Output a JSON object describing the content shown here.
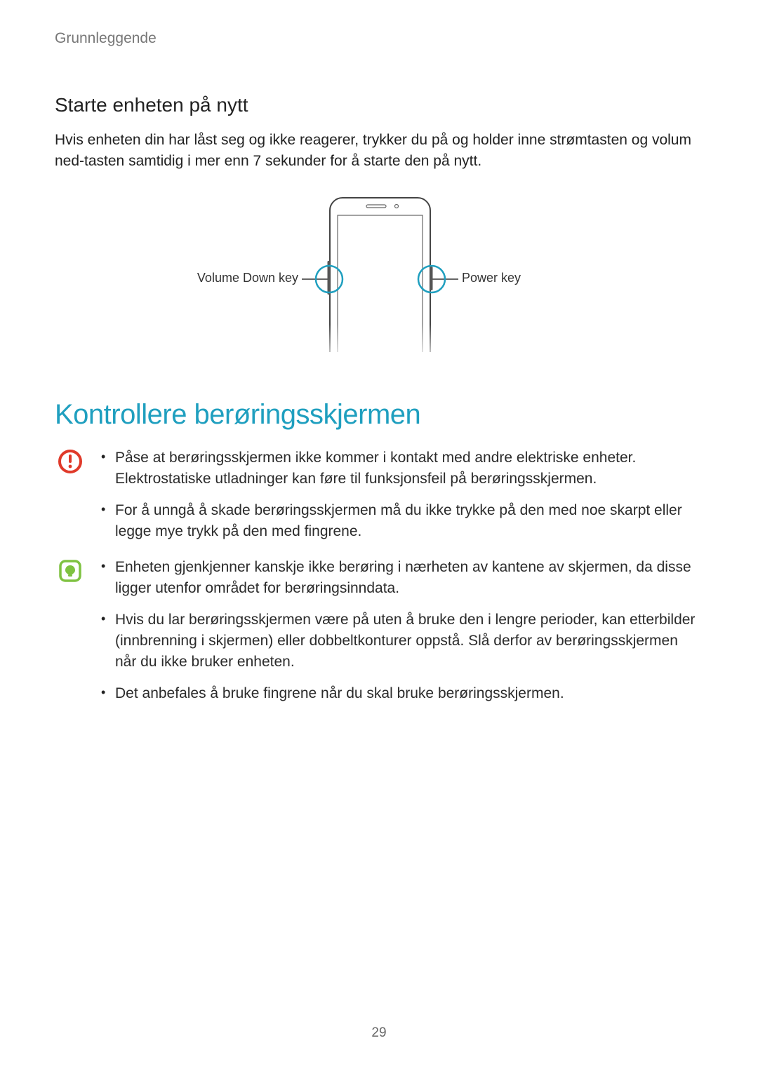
{
  "chapter": "Grunnleggende",
  "section": {
    "heading": "Starte enheten på nytt",
    "body": "Hvis enheten din har låst seg og ikke reagerer, trykker du på og holder inne strømtasten og volum ned-tasten samtidig i mer enn 7 sekunder for å starte den på nytt."
  },
  "diagram": {
    "left_label": "Volume Down key",
    "right_label": "Power key"
  },
  "main_heading": "Kontrollere berøringsskjermen",
  "caution": {
    "items": [
      "Påse at berøringsskjermen ikke kommer i kontakt med andre elektriske enheter. Elektrostatiske utladninger kan føre til funksjonsfeil på berøringsskjermen.",
      "For å unngå å skade berøringsskjermen må du ikke trykke på den med noe skarpt eller legge mye trykk på den med fingrene."
    ]
  },
  "note": {
    "items": [
      "Enheten gjenkjenner kanskje ikke berøring i nærheten av kantene av skjermen, da disse ligger utenfor området for berøringsinndata.",
      "Hvis du lar berøringsskjermen være på uten å bruke den i lengre perioder, kan etterbilder (innbrenning i skjermen) eller dobbeltkonturer oppstå. Slå derfor av berøringsskjermen når du ikke bruker enheten.",
      "Det anbefales å bruke fingrene når du skal bruke berøringsskjermen."
    ]
  },
  "page_number": "29",
  "colors": {
    "accent": "#1f9fbf",
    "caution": "#e03a2a",
    "note": "#7fc241"
  }
}
